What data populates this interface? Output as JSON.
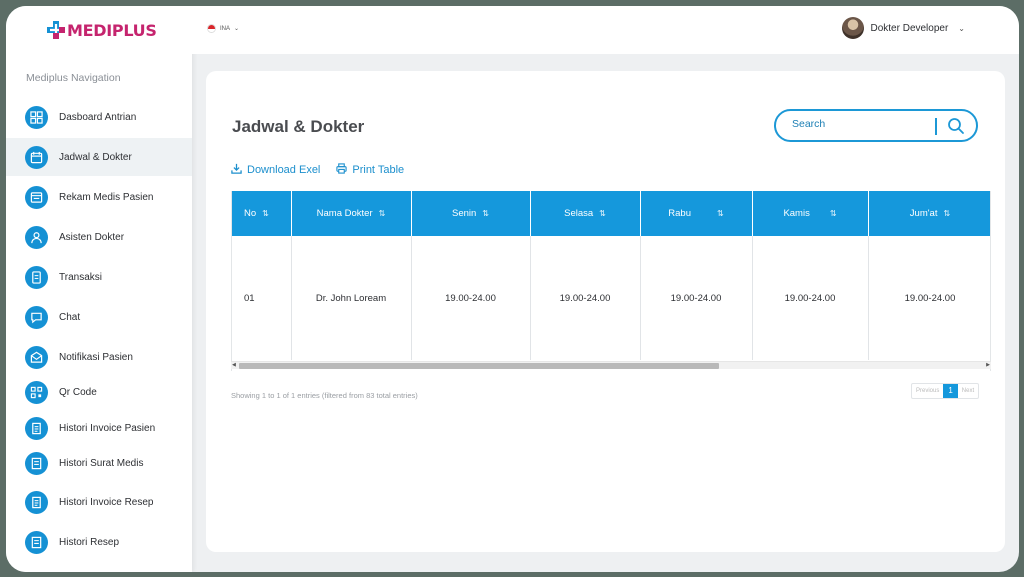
{
  "brand": {
    "name": "MEDIPLUS"
  },
  "sidebar": {
    "caption": "Mediplus Navigation",
    "items": [
      {
        "label": "Dasboard Antrian",
        "icon": "dashboard-icon"
      },
      {
        "label": "Jadwal & Dokter",
        "icon": "calendar-icon",
        "active": true
      },
      {
        "label": "Rekam Medis Pasien",
        "icon": "medical-record-icon"
      },
      {
        "label": "Asisten Dokter",
        "icon": "assistant-icon"
      },
      {
        "label": "Transaksi",
        "icon": "transaction-icon"
      },
      {
        "label": "Chat",
        "icon": "chat-icon"
      },
      {
        "label": "Notifikasi Pasien",
        "icon": "notification-icon"
      },
      {
        "label": "Qr Code",
        "icon": "qr-code-icon"
      },
      {
        "label": "Histori Invoice Pasien",
        "icon": "invoice-icon"
      },
      {
        "label": "Histori Surat Medis",
        "icon": "document-icon"
      },
      {
        "label": "Histori Invoice Resep",
        "icon": "invoice-icon"
      },
      {
        "label": "Histori Resep",
        "icon": "document-icon"
      }
    ]
  },
  "topbar": {
    "language": "INA",
    "user_name": "Dokter Developer"
  },
  "main": {
    "title": "Jadwal & Dokter",
    "search_placeholder": "Search",
    "download_label": "Download Exel",
    "print_label": "Print Table",
    "table": {
      "columns": [
        "No",
        "Nama Dokter",
        "Senin",
        "Selasa",
        "Rabu",
        "Kamis",
        "Jum'at"
      ],
      "rows": [
        [
          "01",
          "Dr. John Loream",
          "19.00-24.00",
          "19.00-24.00",
          "19.00-24.00",
          "19.00-24.00",
          "19.00-24.00"
        ]
      ]
    },
    "entries_text": "Showing 1 to 1 of 1 entries (filtered from 83 total entries)",
    "pagination": {
      "previous": "Previous",
      "current": "1",
      "next": "Next"
    }
  },
  "colors": {
    "accent": "#1598dc",
    "brand_magenta": "#c5246e",
    "brand_blue": "#1591d4"
  }
}
